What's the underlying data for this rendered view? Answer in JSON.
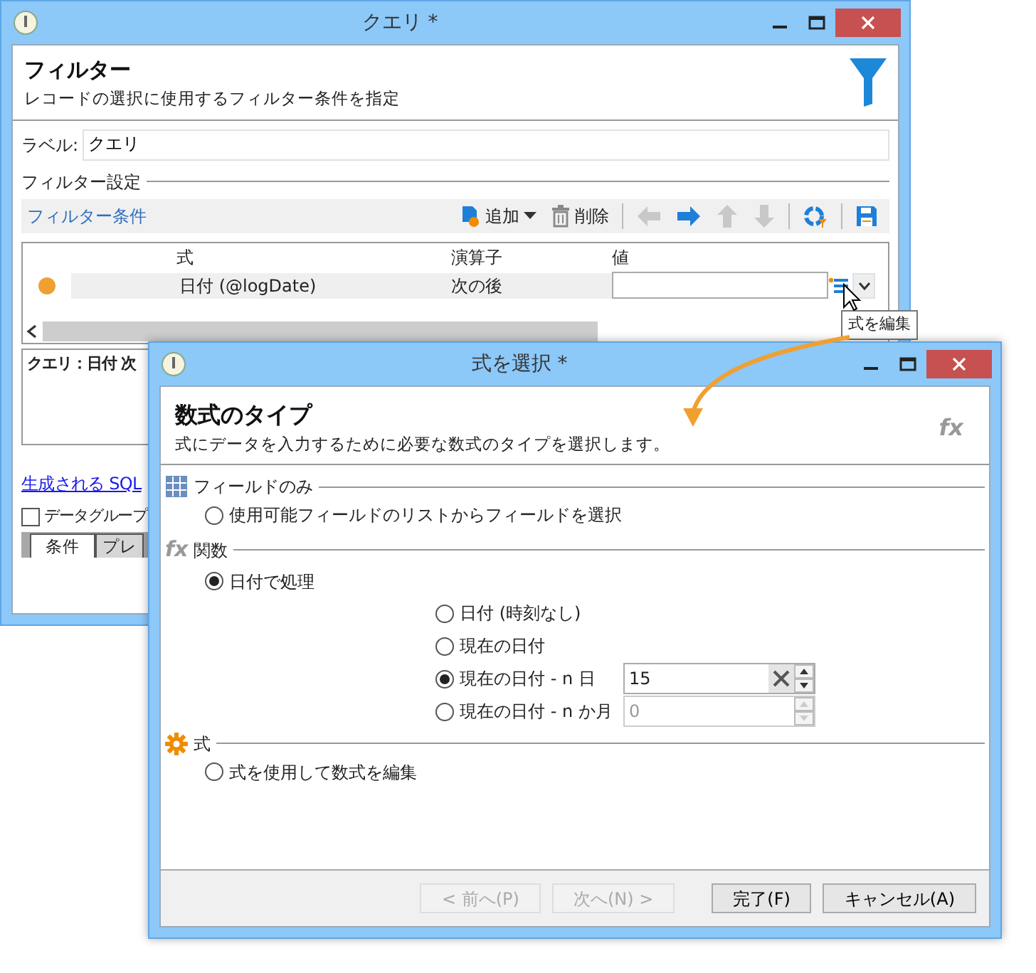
{
  "query_window": {
    "title": "クエリ *",
    "header_title": "フィルター",
    "header_subtitle": "レコードの選択に使用するフィルター条件を指定",
    "label_caption": "ラベル:",
    "label_value": "クエリ",
    "section_title": "フィルター設定",
    "toolbar": {
      "title": "フィルター条件",
      "buttons": [
        {
          "kind": "add",
          "label": "追加",
          "disabled": false
        },
        {
          "kind": "delete",
          "label": "削除",
          "disabled": false
        },
        {
          "kind": "left",
          "disabled": true
        },
        {
          "kind": "right",
          "disabled": false
        },
        {
          "kind": "up",
          "disabled": true
        },
        {
          "kind": "down",
          "disabled": true
        },
        {
          "kind": "refresh",
          "disabled": false
        },
        {
          "kind": "save",
          "disabled": false
        }
      ]
    },
    "grid": {
      "columns": [
        "式",
        "演算子",
        "値"
      ],
      "rows": [
        {
          "color": "#f0a030",
          "expression": "日付 (@logDate)",
          "operator": "次の後"
        }
      ]
    },
    "tooltip": "式を編集",
    "summary": "クエリ：日付 次",
    "sql_link": "生成される SQL",
    "group_checkbox": {
      "label": "データグループ",
      "checked": false
    },
    "tabs": [
      {
        "label": "条件",
        "selected": true
      },
      {
        "label": "プレ",
        "selected": false
      }
    ]
  },
  "expression_window": {
    "title": "式を選択 *",
    "header_title": "数式のタイプ",
    "header_subtitle": "式にデータを入力するために必要な数式のタイプを選択します。",
    "header_icon_text": "fx",
    "sections": [
      {
        "kind": "fields",
        "title": "フィールドのみ",
        "options": [
          {
            "label": "使用可能フィールドのリストからフィールドを選択",
            "selected": false
          }
        ]
      },
      {
        "kind": "function",
        "icon_text": "fx",
        "title": "関数",
        "options": [
          {
            "label": "日付で処理",
            "selected": true,
            "children": [
              {
                "label": "日付 (時刻なし)",
                "selected": false
              },
              {
                "label": "現在の日付",
                "selected": false
              },
              {
                "label": "現在の日付 - n 日",
                "selected": true,
                "input": {
                  "value": "15",
                  "disabled": false
                }
              },
              {
                "label": "現在の日付 - n か月",
                "selected": false,
                "input": {
                  "value": "0",
                  "disabled": true
                }
              }
            ]
          }
        ]
      },
      {
        "kind": "expression",
        "title": "式",
        "options": [
          {
            "label": "式を使用して数式を編集",
            "selected": false
          }
        ]
      }
    ],
    "buttons": [
      {
        "label": "< 前へ(P)",
        "disabled": true
      },
      {
        "label": "次へ(N) >",
        "disabled": true
      },
      {
        "label": "完了(F)",
        "disabled": false
      },
      {
        "label": "キャンセル(A)",
        "disabled": false
      }
    ]
  }
}
